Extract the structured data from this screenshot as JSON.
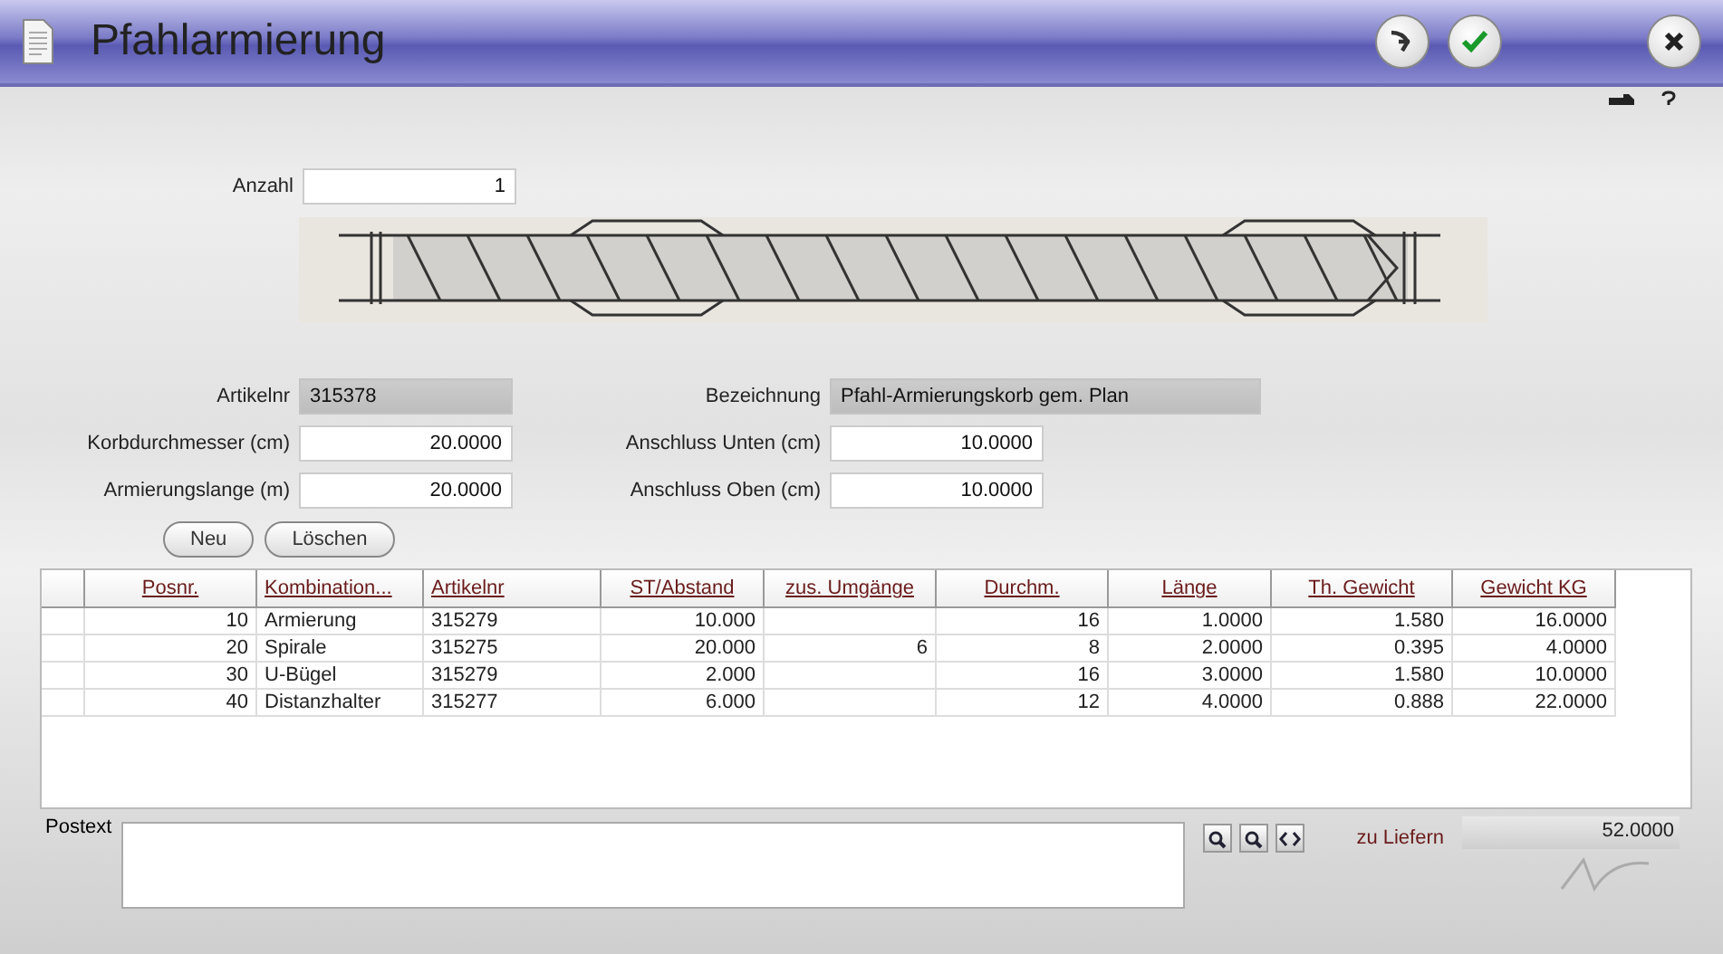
{
  "window": {
    "title": "Pfahlarmierung"
  },
  "quantity": {
    "label": "Anzahl",
    "value": "1"
  },
  "left_fields": [
    {
      "label": "Artikelnr",
      "value": "315378",
      "readonly": true
    },
    {
      "label": "Korbdurchmesser (cm)",
      "value": "20.0000",
      "readonly": false
    },
    {
      "label": "Armierungslange (m)",
      "value": "20.0000",
      "readonly": false
    }
  ],
  "right_fields": [
    {
      "label": "Bezeichnung",
      "value": "Pfahl-Armierungskorb gem. Plan",
      "readonly": true
    },
    {
      "label": "Anschluss Unten (cm)",
      "value": "10.0000",
      "readonly": false
    },
    {
      "label": "Anschluss Oben (cm)",
      "value": "10.0000",
      "readonly": false
    }
  ],
  "buttons": [
    "Neu",
    "Löschen"
  ],
  "table": {
    "columns": [
      {
        "label": "Posnr.",
        "kind": "number"
      },
      {
        "label": "Kombination...",
        "kind": "text"
      },
      {
        "label": "Artikelnr",
        "kind": "text"
      },
      {
        "label": "ST/Abstand",
        "kind": "number"
      },
      {
        "label": "zus. Umgänge",
        "kind": "number"
      },
      {
        "label": "Durchm.",
        "kind": "number"
      },
      {
        "label": "Länge",
        "kind": "number"
      },
      {
        "label": "Th. Gewicht",
        "kind": "number"
      },
      {
        "label": "Gewicht KG",
        "kind": "number"
      }
    ],
    "rows": [
      [
        "10",
        "Armierung",
        "315279",
        "10.000",
        "",
        "16",
        "1.0000",
        "1.580",
        "16.0000"
      ],
      [
        "20",
        "Spirale",
        "315275",
        "20.000",
        "6",
        "8",
        "2.0000",
        "0.395",
        "4.0000"
      ],
      [
        "30",
        "U-Bügel",
        "315279",
        "2.000",
        "",
        "16",
        "3.0000",
        "1.580",
        "10.0000"
      ],
      [
        "40",
        "Distanzhalter",
        "315277",
        "6.000",
        "",
        "12",
        "4.0000",
        "0.888",
        "22.0000"
      ]
    ]
  },
  "footer": {
    "postext_label": "Postext",
    "delivery_label": "zu Liefern",
    "delivery_value": "52.0000"
  }
}
